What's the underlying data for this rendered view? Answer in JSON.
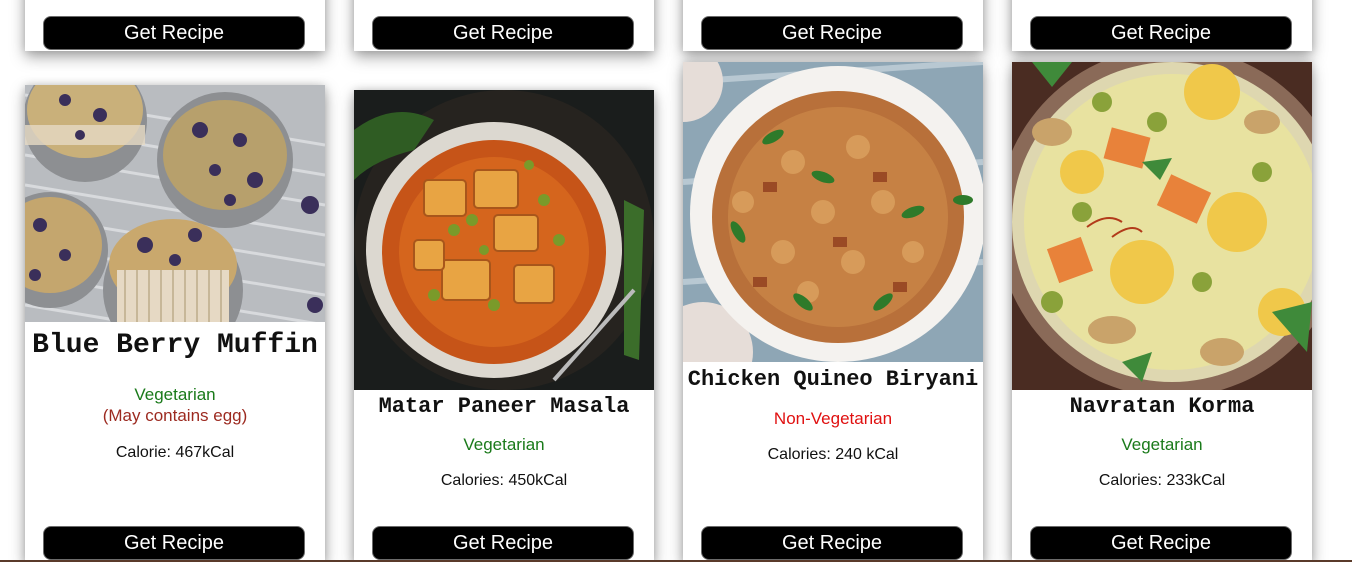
{
  "top_row": [
    {
      "button_label": "Get Recipe"
    },
    {
      "button_label": "Get Recipe"
    },
    {
      "button_label": "Get Recipe"
    },
    {
      "button_label": "Get Recipe"
    }
  ],
  "cards": [
    {
      "title": "Blue Berry Muffin",
      "diet": "Vegetarian",
      "diet_note": "(May contains egg)",
      "calories": "Calorie: 467kCal",
      "button_label": "Get Recipe",
      "image_alt": "blueberry-muffins-photo"
    },
    {
      "title": "Matar Paneer Masala",
      "diet": "Vegetarian",
      "calories": "Calories: 450kCal",
      "button_label": "Get Recipe",
      "image_alt": "matar-paneer-photo"
    },
    {
      "title": "Chicken Quineo Biryani",
      "diet": "Non-Vegetarian",
      "calories": "Calories: 240 kCal",
      "button_label": "Get Recipe",
      "image_alt": "quinoa-biryani-photo"
    },
    {
      "title": "Navratan Korma",
      "diet": "Vegetarian",
      "calories": "Calories: 233kCal",
      "button_label": "Get Recipe",
      "image_alt": "navratan-korma-photo"
    }
  ],
  "colors": {
    "vegetarian": "#1a7a1a",
    "non_vegetarian": "#e01010",
    "note": "#9c2a20",
    "button_bg": "#000000",
    "button_text": "#ffffff"
  }
}
